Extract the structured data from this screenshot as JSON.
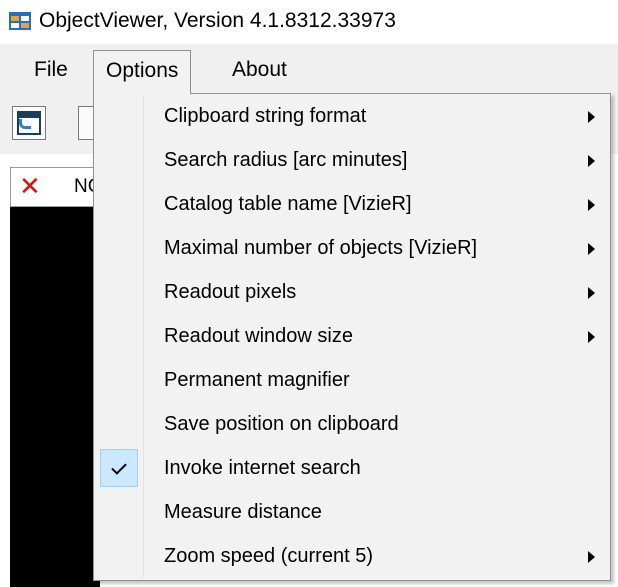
{
  "window": {
    "title": "ObjectViewer, Version 4.1.8312.33973",
    "app_icon": "app-window-icon"
  },
  "menubar": {
    "items": [
      {
        "label": "File"
      },
      {
        "label": "Options",
        "open": true
      },
      {
        "label": "About"
      }
    ]
  },
  "toolbar": {
    "buttons": [
      {
        "icon": "new-window-icon"
      },
      {
        "icon": "toolbar-button-icon"
      }
    ]
  },
  "document_tab": {
    "label": "NG",
    "close_icon": "close-icon",
    "close_color": "#d11414"
  },
  "options_menu": {
    "items": [
      {
        "label": "Clipboard string format",
        "submenu": true,
        "checked": false
      },
      {
        "label": "Search radius [arc minutes]",
        "submenu": true,
        "checked": false
      },
      {
        "label": "Catalog table name [VizieR]",
        "submenu": true,
        "checked": false
      },
      {
        "label": "Maximal number of objects [VizieR]",
        "submenu": true,
        "checked": false
      },
      {
        "label": "Readout pixels",
        "submenu": true,
        "checked": false
      },
      {
        "label": "Readout window size",
        "submenu": true,
        "checked": false
      },
      {
        "label": "Permanent magnifier",
        "submenu": false,
        "checked": false
      },
      {
        "label": "Save position on clipboard",
        "submenu": false,
        "checked": false
      },
      {
        "label": "Invoke internet search",
        "submenu": false,
        "checked": true
      },
      {
        "label": "Measure distance",
        "submenu": false,
        "checked": false
      },
      {
        "label": "Zoom speed (current 5)",
        "submenu": true,
        "checked": false
      }
    ]
  },
  "colors": {
    "menubar_bg": "#f0f0f0",
    "menu_bg": "#f2f2f2",
    "check_highlight": "#cce8ff",
    "image_bg": "#000000"
  }
}
